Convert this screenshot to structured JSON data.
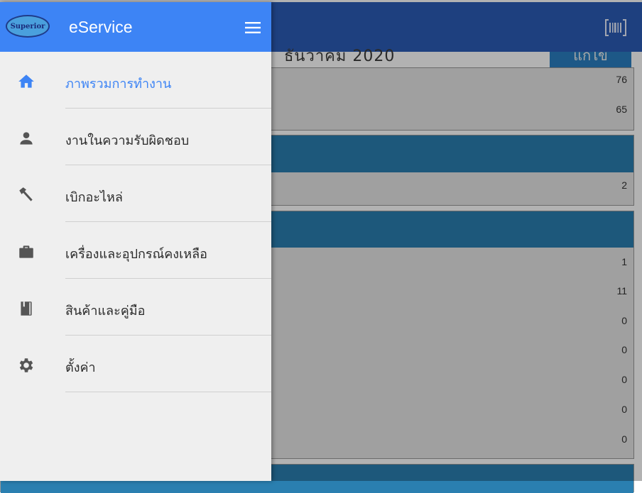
{
  "background": {
    "month_label": "ธันวาคม 2020",
    "view_button": "แก้ไข",
    "cards": [
      {
        "values": [
          "76",
          "65"
        ]
      },
      {
        "values": [
          "2"
        ]
      },
      {
        "values": [
          "1",
          "11",
          "0",
          "0",
          "0",
          "0",
          "0"
        ]
      }
    ]
  },
  "drawer": {
    "logo_text": "Superior",
    "app_title": "eService",
    "menu": [
      {
        "label": "ภาพรวมการทำงาน",
        "icon": "home-icon",
        "active": true
      },
      {
        "label": "งานในความรับผิดชอบ",
        "icon": "person-icon",
        "active": false
      },
      {
        "label": "เบิกอะไหล่",
        "icon": "hammer-icon",
        "active": false
      },
      {
        "label": "เครื่องและอุปกรณ์คงเหลือ",
        "icon": "briefcase-icon",
        "active": false
      },
      {
        "label": "สินค้าและคู่มือ",
        "icon": "book-icon",
        "active": false
      },
      {
        "label": "ตั้งค่า",
        "icon": "gear-icon",
        "active": false
      }
    ]
  },
  "colors": {
    "drawer_header": "#3d84f5",
    "topbar": "#2b5cb6",
    "active_text": "#3d84f5",
    "card_header": "#2a7fb0"
  }
}
